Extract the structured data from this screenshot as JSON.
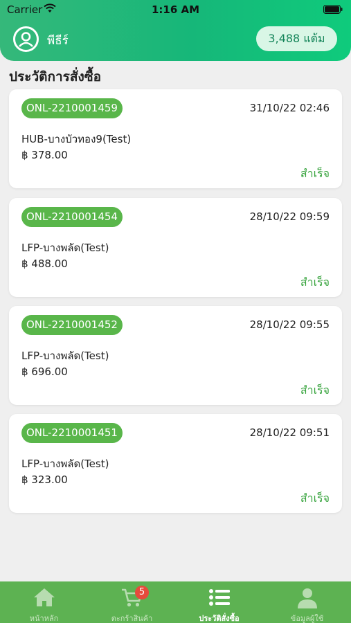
{
  "status_bar": {
    "carrier": "Carrier",
    "time": "1:16 AM"
  },
  "header": {
    "user_name": "พีธีร์",
    "points": "3,488 แต้ม"
  },
  "page": {
    "title": "ประวัติการสั่งซื้อ"
  },
  "orders": [
    {
      "id": "ONL-2210001459",
      "date": "31/10/22 02:46",
      "store": "HUB-บางบัวทอง9(Test)",
      "amount": "฿ 378.00",
      "status": "สำเร็จ"
    },
    {
      "id": "ONL-2210001454",
      "date": "28/10/22 09:59",
      "store": "LFP-บางพลัด(Test)",
      "amount": "฿ 488.00",
      "status": "สำเร็จ"
    },
    {
      "id": "ONL-2210001452",
      "date": "28/10/22 09:55",
      "store": "LFP-บางพลัด(Test)",
      "amount": "฿ 696.00",
      "status": "สำเร็จ"
    },
    {
      "id": "ONL-2210001451",
      "date": "28/10/22 09:51",
      "store": "LFP-บางพลัด(Test)",
      "amount": "฿ 323.00",
      "status": "สำเร็จ"
    }
  ],
  "bottom_nav": [
    {
      "label": "หน้าหลัก",
      "icon": "home-icon",
      "active": false
    },
    {
      "label": "ตะกร้าสินค้า",
      "icon": "cart-icon",
      "badge": "5",
      "active": false
    },
    {
      "label": "ประวัติสั่งซื้อ",
      "icon": "list-icon",
      "active": true
    },
    {
      "label": "ข้อมูลผู้ใช้",
      "icon": "user-icon",
      "active": false
    }
  ],
  "colors": {
    "brand_green": "#16b779",
    "status_green": "#3aa540",
    "badge_green": "#59b64a",
    "nav_green": "#5db252",
    "cart_badge_red": "#e74b3c"
  }
}
